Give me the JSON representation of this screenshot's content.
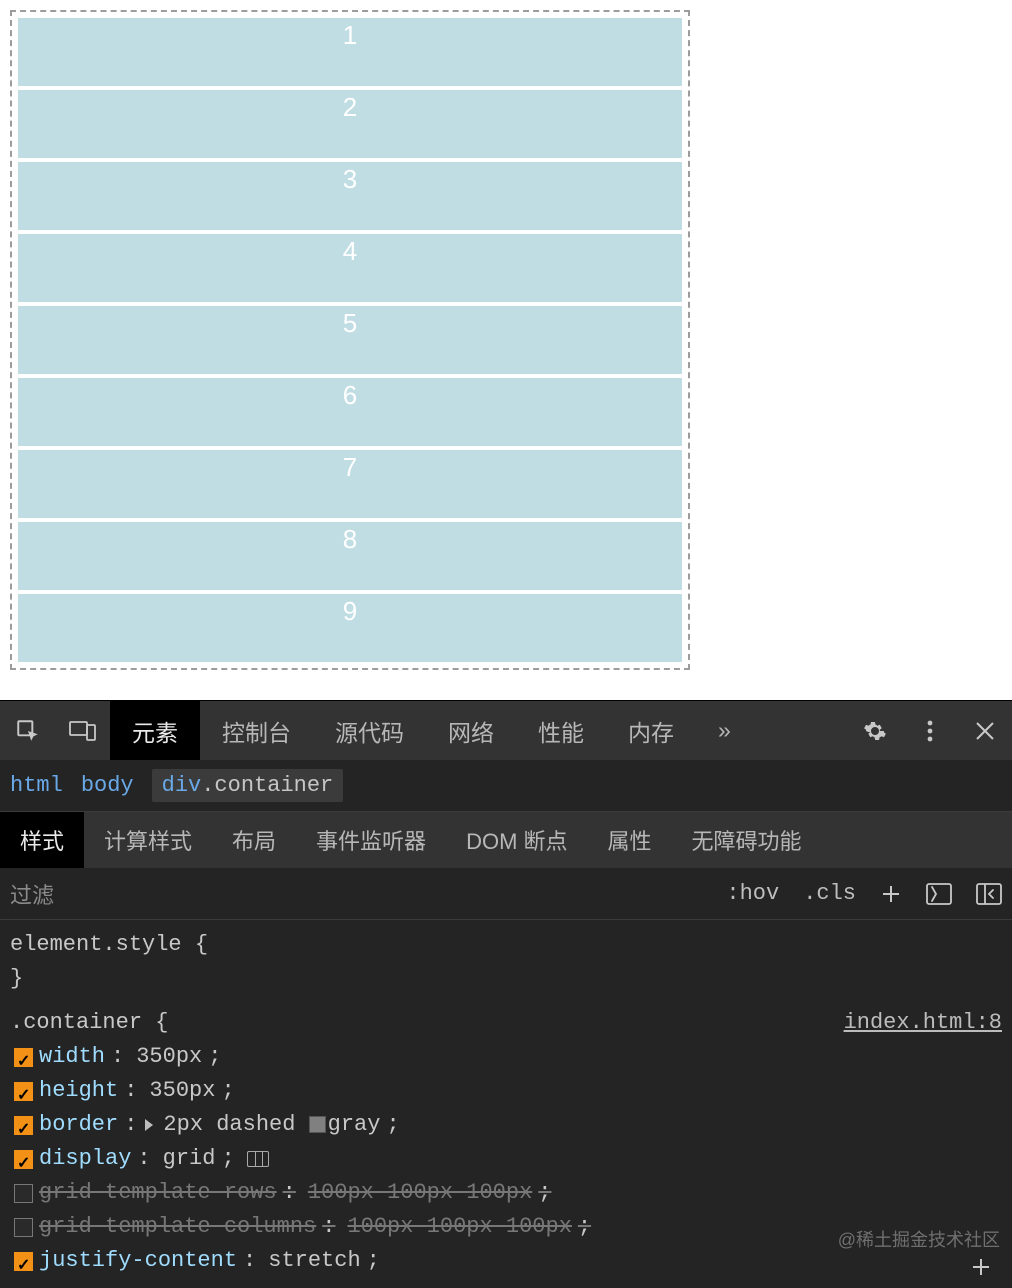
{
  "preview": {
    "items": [
      "1",
      "2",
      "3",
      "4",
      "5",
      "6",
      "7",
      "8",
      "9"
    ]
  },
  "devtools": {
    "mainTabs": [
      "元素",
      "控制台",
      "源代码",
      "网络",
      "性能",
      "内存"
    ],
    "overflow": "»",
    "breadcrumb": {
      "items": [
        "html",
        "body"
      ],
      "currentTag": "div",
      "currentClass": ".container"
    },
    "subTabs": [
      "样式",
      "计算样式",
      "布局",
      "事件监听器",
      "DOM 断点",
      "属性",
      "无障碍功能"
    ],
    "filter": {
      "placeholder": "过滤",
      "hov": ":hov",
      "cls": ".cls"
    },
    "styles": {
      "elementStyle": {
        "selector": "element.style",
        "open": "{",
        "close": "}"
      },
      "rule": {
        "selector": ".container",
        "open": "{",
        "source": "index.html:8",
        "lines": [
          {
            "enabled": true,
            "prop": "width",
            "val": "350px",
            "special": null
          },
          {
            "enabled": true,
            "prop": "height",
            "val": "350px",
            "special": null
          },
          {
            "enabled": true,
            "prop": "border",
            "val": "2px dashed gray",
            "special": "border"
          },
          {
            "enabled": true,
            "prop": "display",
            "val": "grid",
            "special": "display"
          },
          {
            "enabled": false,
            "prop": "grid-template-rows",
            "val": "100px 100px 100px",
            "special": null
          },
          {
            "enabled": false,
            "prop": "grid-template-columns",
            "val": "100px 100px 100px",
            "special": null
          },
          {
            "enabled": true,
            "prop": "justify-content",
            "val": "stretch",
            "special": null
          }
        ]
      }
    },
    "watermark": "@稀土掘金技术社区"
  }
}
